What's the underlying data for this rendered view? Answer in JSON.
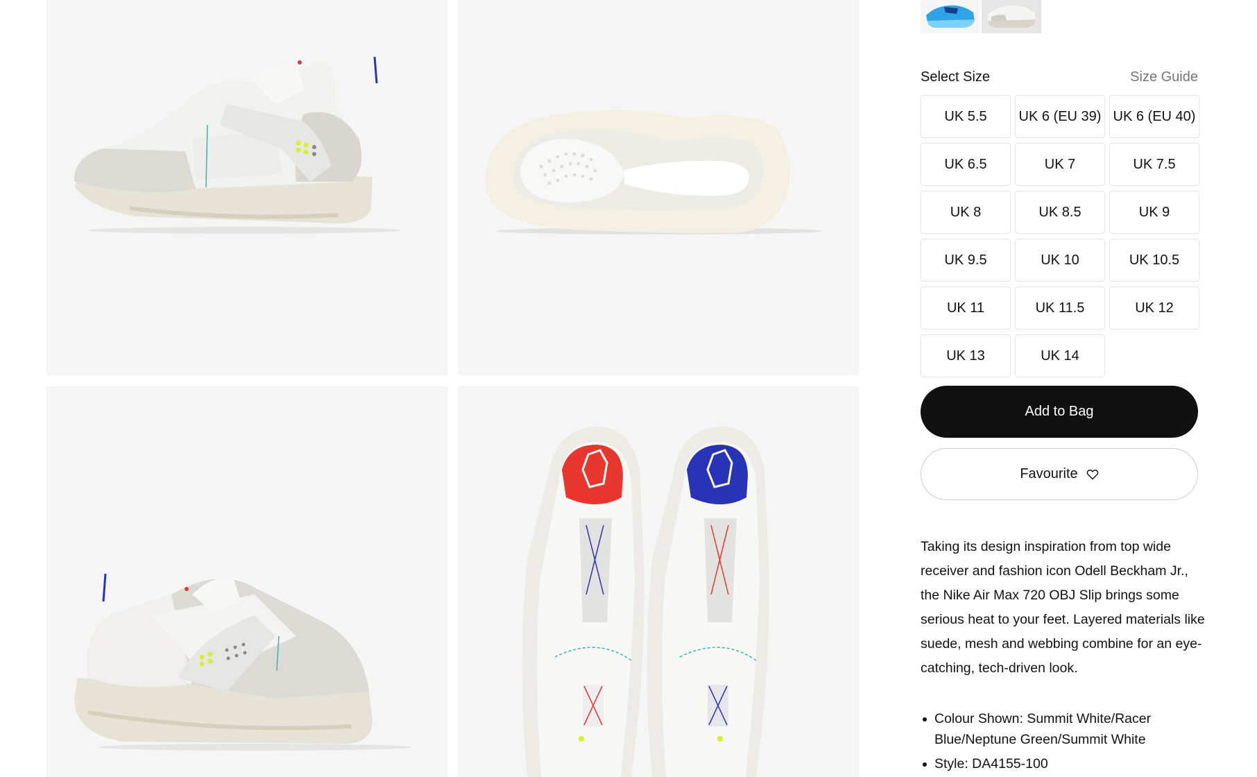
{
  "gallery": {
    "images": [
      {
        "name": "shoe-lateral-view"
      },
      {
        "name": "shoe-sole-view"
      },
      {
        "name": "shoe-medial-view"
      },
      {
        "name": "shoe-top-view-pair"
      }
    ]
  },
  "colorways": [
    {
      "name": "blue-colorway",
      "color": "#2ea3e6",
      "selected": false
    },
    {
      "name": "white-colorway",
      "color": "#e0e0dc",
      "selected": true
    }
  ],
  "size_selector": {
    "title": "Select Size",
    "guide_label": "Size Guide",
    "sizes": [
      "UK 5.5",
      "UK 6 (EU 39)",
      "UK 6 (EU 40)",
      "UK 6.5",
      "UK 7",
      "UK 7.5",
      "UK 8",
      "UK 8.5",
      "UK 9",
      "UK 9.5",
      "UK 10",
      "UK 10.5",
      "UK 11",
      "UK 11.5",
      "UK 12",
      "UK 13",
      "UK 14"
    ]
  },
  "actions": {
    "add_to_bag": "Add to Bag",
    "favourite": "Favourite"
  },
  "description": "Taking its design inspiration from top wide receiver and fashion icon Odell Beckham Jr., the Nike Air Max 720 OBJ Slip brings some serious heat to your feet. Layered materials like suede, mesh and webbing combine for an eye-catching, tech-driven look.",
  "details": [
    "Colour Shown: Summit White/Racer Blue/Neptune Green/Summit White",
    "Style: DA4155-100"
  ],
  "colors": {
    "button_dark": "#111111",
    "tile_bg": "#f5f5f5",
    "muted_text": "#757575",
    "accent_volt": "#d7f02c",
    "accent_red": "#e8362f",
    "accent_blue": "#2833b8"
  }
}
